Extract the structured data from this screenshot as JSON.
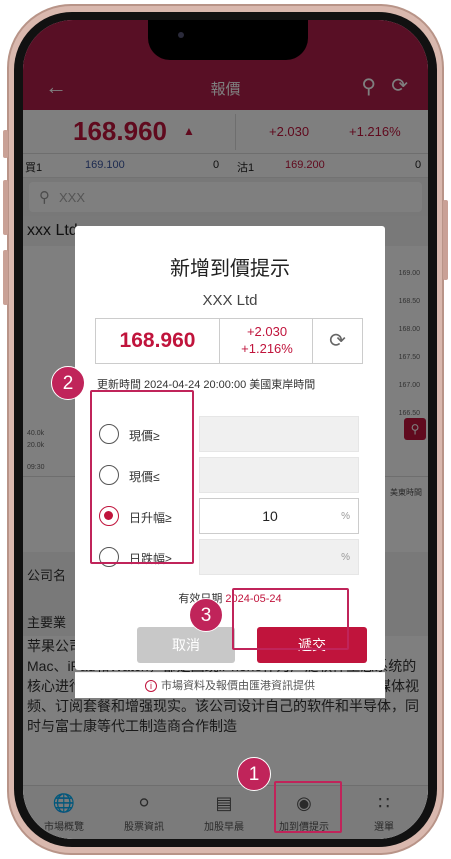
{
  "header": {
    "title": "報價",
    "back_icon": "back-arrow-icon",
    "search_icon": "search-icon",
    "refresh_icon": "refresh-icon"
  },
  "quote": {
    "price": "168.960",
    "change": "+2.030",
    "percent": "+1.216%"
  },
  "bid_ask": {
    "bid_label": "買1",
    "bid_price": "169.100",
    "bid_qty": "0",
    "ask_label": "沽1",
    "ask_price": "169.200",
    "ask_qty": "0"
  },
  "search": {
    "placeholder": "XXX"
  },
  "stock_name": "xxx Ltd",
  "chart_labels": [
    "169.00",
    "168.50",
    "168.00",
    "167.50",
    "167.00",
    "166.50"
  ],
  "chart_left_labels": [
    "40.0k",
    "20.0k",
    "09:30"
  ],
  "tabs_right_label": "美東時間",
  "company_label": "公司名",
  "main_label": "主要業",
  "description": "苹果公司是全球最大的科技公司之一，其产品包括iPhone、Mac、iPad和Watch，都是围绕iPhone作为广泛软件生态系统的核心进行设计的。苹果不断努力增加新的应用程序，如流媒体视频、订阅套餐和增强现实。该公司设计自己的软件和半导体，同时与富士康等代工制造商合作制造",
  "modal": {
    "title": "新增到價提示",
    "stock": "XXX Ltd",
    "price": "168.960",
    "change": "+2.030",
    "percent": "+1.216%",
    "update_time": "更新時間 2024-04-24 20:00:00 美國東岸時間",
    "options": [
      {
        "label": "現價≥",
        "value": "",
        "unit": "",
        "selected": false
      },
      {
        "label": "現價≤",
        "value": "",
        "unit": "",
        "selected": false
      },
      {
        "label": "日升幅≥",
        "value": "10",
        "unit": "%",
        "selected": true
      },
      {
        "label": "日跌幅≥",
        "value": "",
        "unit": "%",
        "selected": false
      }
    ],
    "expiry_label": "有效日期",
    "expiry_date": "2024-05-24",
    "cancel": "取消",
    "submit": "遞交"
  },
  "footer_note": "市場資料及報價由匯港資訊提供",
  "bottom_nav": [
    {
      "label": "市場概覽",
      "icon": "globe-icon"
    },
    {
      "label": "股票資訊",
      "icon": "dollar-icon"
    },
    {
      "label": "加股早晨",
      "icon": "document-icon"
    },
    {
      "label": "加到價提示",
      "icon": "alert-icon"
    },
    {
      "label": "選單",
      "icon": "grid-icon"
    }
  ],
  "steps": [
    "1",
    "2",
    "3"
  ],
  "colors": {
    "brand": "#b01e4a",
    "accent": "#c0143c",
    "annotation": "#c0245a"
  }
}
